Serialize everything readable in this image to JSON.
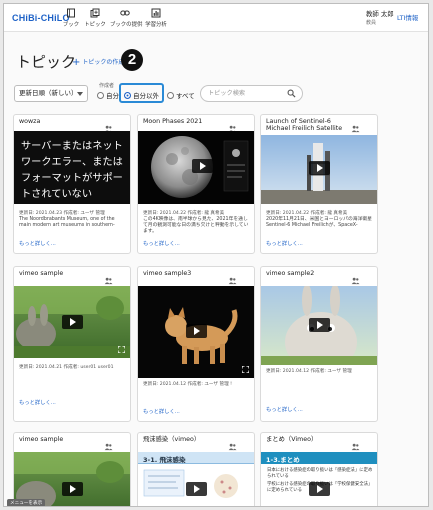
{
  "app": {
    "logo": "CHiBi-CHiLO",
    "nav": [
      {
        "label": "ブック",
        "icon": "book-icon"
      },
      {
        "label": "トピック",
        "icon": "topic-icon"
      },
      {
        "label": "ブックの提供",
        "icon": "link-icon"
      },
      {
        "label": "学習分析",
        "icon": "analytics-icon"
      }
    ],
    "user_name": "教師 太郎",
    "user_role": "教員",
    "lti_label": "LTI情報"
  },
  "page": {
    "title": "トピック",
    "create_label": "トピックの作成",
    "step_number": "2"
  },
  "filters": {
    "sort_value": "更新日順（新しい）",
    "creator_label": "作成者",
    "options": [
      "自分",
      "自分以外",
      "すべて"
    ],
    "selected": "自分以外",
    "search_placeholder": "トピック検索"
  },
  "cards": [
    {
      "title": "wowza",
      "thumb_text": "サーバーまたはネットワークエラー、またはフォーマットがサポートされていない",
      "meta": "更新日: 2021.04.23 作成者: ユーザ 管理",
      "desc": "The Noordbrabants Museum, one of the main modern art museums in southern-",
      "more": "もっと詳しく..."
    },
    {
      "title": "Moon Phases 2021",
      "meta": "更新日: 2021.04.22 作成者: 龍 真希美",
      "desc": "この4K映像は、南半球から見た、2021年を通して月の観測可能な日の満ち欠けと秤動を示しています。",
      "more": "もっと詳しく..."
    },
    {
      "title": "Launch of Sentinel-6 Michael Freilich Satellite",
      "meta": "更新日: 2021.04.22 作成者: 龍 真希美",
      "desc": "2020年11月21日、米国とヨーロッパの海洋衛星Sentinel-6 Michael Freilichが、SpaceX-",
      "more": "もっと詳しく..."
    },
    {
      "title": "vimeo sample",
      "meta": "更新日: 2021.04.21 作成者: user01 user01",
      "desc": "",
      "more": "もっと詳しく..."
    },
    {
      "title": "vimeo sample3",
      "meta": "更新日: 2021.04.12 作成者: ユーザ 管理 !",
      "desc": "",
      "more": "もっと詳しく..."
    },
    {
      "title": "vimeo sample2",
      "meta": "更新日: 2021.04.12 作成者: ユーザ 管理",
      "desc": "",
      "more": "もっと詳しく..."
    },
    {
      "title": "vimeo sample",
      "meta": "",
      "desc": "",
      "more": ""
    },
    {
      "title": "飛沫感染（vimeo）",
      "slide_heading": "3-1. 飛沫感染",
      "meta": "",
      "desc": "",
      "more": ""
    },
    {
      "title": "まとめ（Vimeo）",
      "slide_heading": "1-3.まとめ",
      "slide_lines": [
        "日本における感染症の取り扱いは「感染症法」に定められている",
        "学校における感染症の取り扱いは「学校保健安全法」に定められている"
      ],
      "meta": "",
      "desc": "",
      "more": ""
    }
  ],
  "footer": {
    "menu_label": "メニューを表示"
  }
}
